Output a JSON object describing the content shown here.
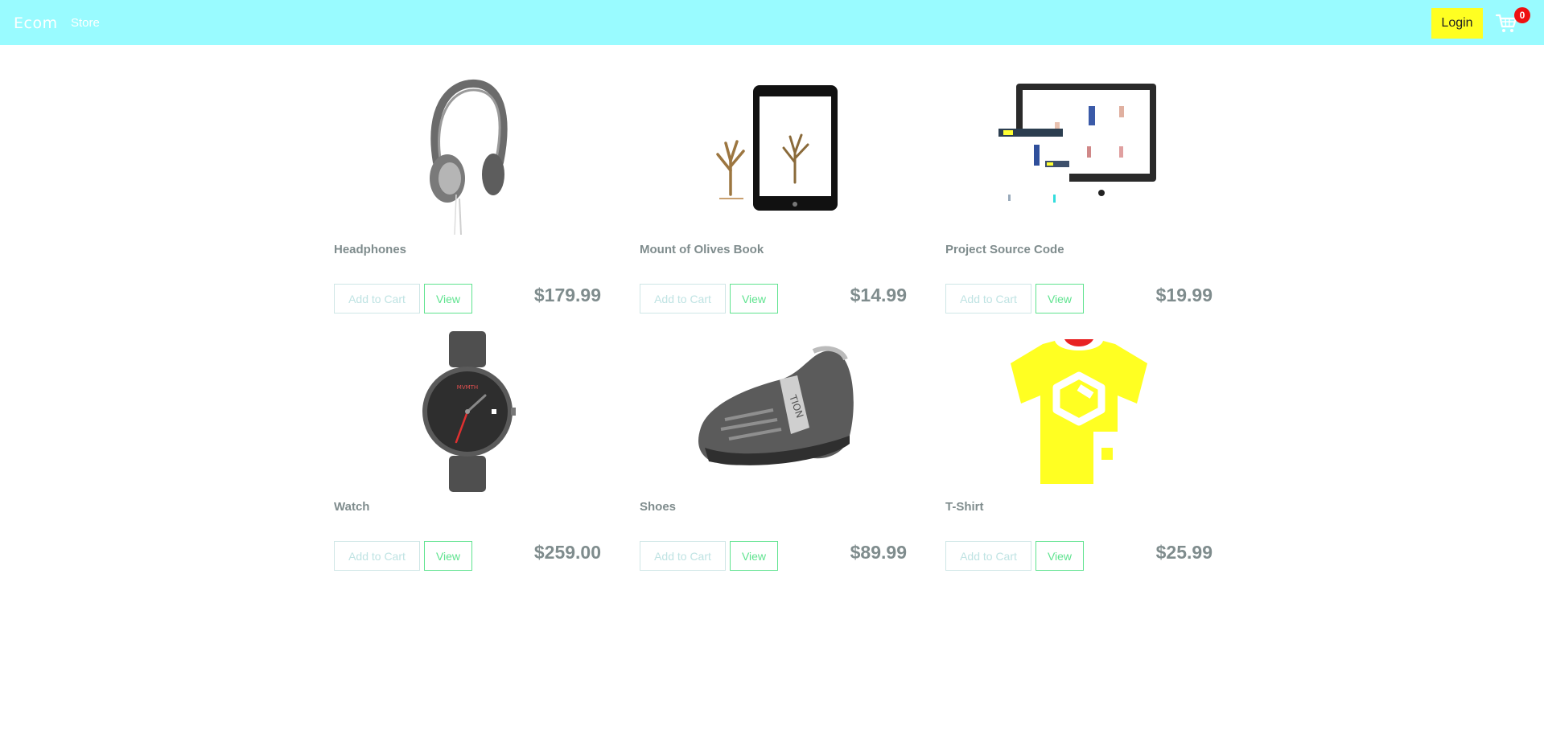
{
  "header": {
    "brand": "Ecom",
    "nav_store": "Store",
    "login_label": "Login",
    "cart_count": "0",
    "bg_color": "#99fbff"
  },
  "products": [
    {
      "title": "Headphones",
      "price": "$179.99",
      "add_label": "Add to Cart",
      "view_label": "View",
      "image": "headphones-image"
    },
    {
      "title": "Mount of Olives Book",
      "price": "$14.99",
      "add_label": "Add to Cart",
      "view_label": "View",
      "image": "tablet-book-image"
    },
    {
      "title": "Project Source Code",
      "price": "$19.99",
      "add_label": "Add to Cart",
      "view_label": "View",
      "image": "monitor-image"
    },
    {
      "title": "Watch",
      "price": "$259.00",
      "add_label": "Add to Cart",
      "view_label": "View",
      "image": "watch-image"
    },
    {
      "title": "Shoes",
      "price": "$89.99",
      "add_label": "Add to Cart",
      "view_label": "View",
      "image": "shoe-image"
    },
    {
      "title": "T-Shirt",
      "price": "$25.99",
      "add_label": "Add to Cart",
      "view_label": "View",
      "image": "tshirt-image"
    }
  ]
}
